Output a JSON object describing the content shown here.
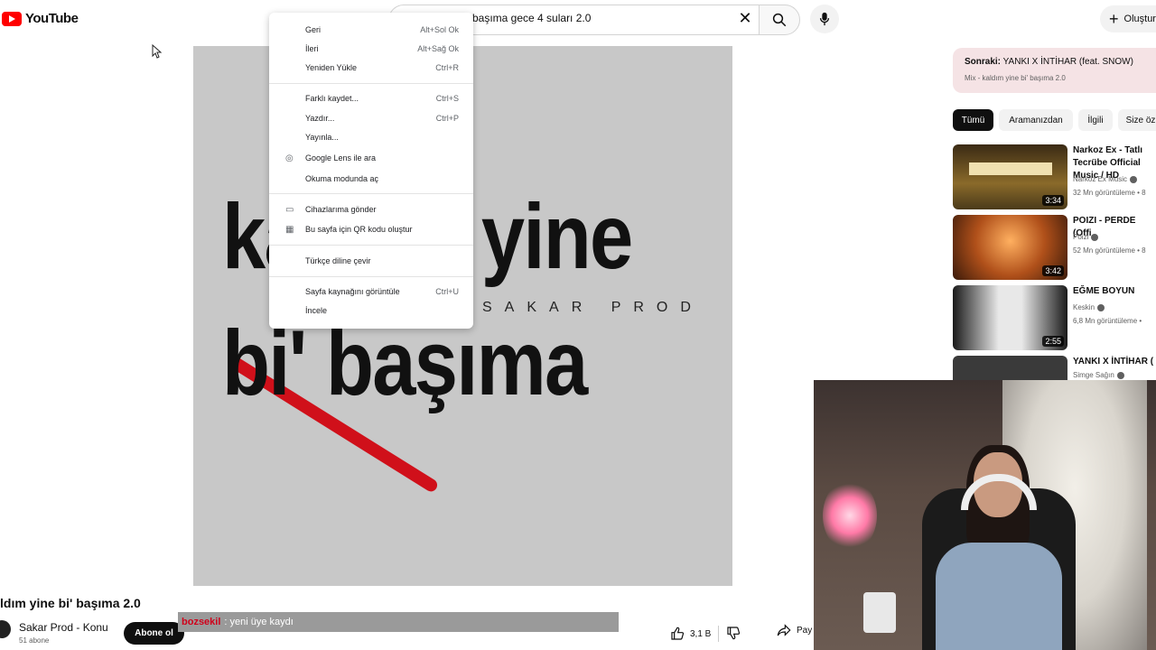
{
  "header": {
    "logo_text": "YouTube",
    "search_value": "başıma gece 4 suları 2.0",
    "create_label": "Oluştur"
  },
  "video": {
    "overlay_line1": "kaldım yine",
    "overlay_line2": "bi' başıma",
    "overlay_brand": "SAKAR PROD",
    "title": "ldım yine bi' başıma 2.0",
    "channel_name": "Sakar Prod - Konu",
    "subscribers": "51 abone",
    "subscribe_label": "Abone ol",
    "likes": "3,1 B",
    "share_label": "Pay"
  },
  "chat": {
    "user": "bozsekil",
    "message": ": yeni üye kaydı"
  },
  "context_menu": {
    "items": [
      {
        "label": "Geri",
        "shortcut": "Alt+Sol Ok"
      },
      {
        "label": "İleri",
        "shortcut": "Alt+Sağ Ok"
      },
      {
        "label": "Yeniden Yükle",
        "shortcut": "Ctrl+R"
      },
      {
        "label": "Farklı kaydet...",
        "shortcut": "Ctrl+S"
      },
      {
        "label": "Yazdır...",
        "shortcut": "Ctrl+P"
      },
      {
        "label": "Yayınla...",
        "shortcut": ""
      },
      {
        "label": "Google Lens ile ara",
        "shortcut": "",
        "icon": "lens-icon"
      },
      {
        "label": "Okuma modunda aç",
        "shortcut": ""
      },
      {
        "label": "Cihazlarıma gönder",
        "shortcut": "",
        "icon": "devices-icon"
      },
      {
        "label": "Bu sayfa için QR kodu oluştur",
        "shortcut": "",
        "icon": "qr-icon"
      },
      {
        "label": "Türkçe diline çevir",
        "shortcut": ""
      },
      {
        "label": "Sayfa kaynağını görüntüle",
        "shortcut": "Ctrl+U"
      },
      {
        "label": "İncele",
        "shortcut": ""
      }
    ]
  },
  "sidebar": {
    "next_label": "Sonraki:",
    "next_title": "YANKI X İNTİHAR (feat. SNOW)",
    "next_sub": "Mix - kaldım yine bi' başıma 2.0",
    "chips": [
      "Tümü",
      "Aramanızdan",
      "İlgili",
      "Size öz"
    ],
    "recommendations": [
      {
        "title": "Narkoz Ex - Tatlı Tecrübe Official Music / HD",
        "channel": "Narkoz Ex Music",
        "views": "32 Mn görüntüleme • 8",
        "duration": "3:34",
        "thumb_color": "#8a6a2a"
      },
      {
        "title": "POIZI - PERDE (Offi",
        "channel": "Poizi",
        "views": "52 Mn görüntüleme • 8",
        "duration": "3:42",
        "thumb_color": "#b0501a"
      },
      {
        "title": "EĞME BOYUN",
        "channel": "Keskin",
        "views": "6,8 Mn görüntüleme •",
        "duration": "2:55",
        "thumb_color": "#2a2a2a"
      },
      {
        "title": "YANKI X İNTİHAR (",
        "channel": "Simge Sağın",
        "views": "",
        "duration": "",
        "thumb_color": "#3a3a3a"
      }
    ]
  },
  "colors": {
    "brand_red": "#ff0000",
    "next_card_bg": "#f5e3e5",
    "chat_user": "#d0021b"
  }
}
